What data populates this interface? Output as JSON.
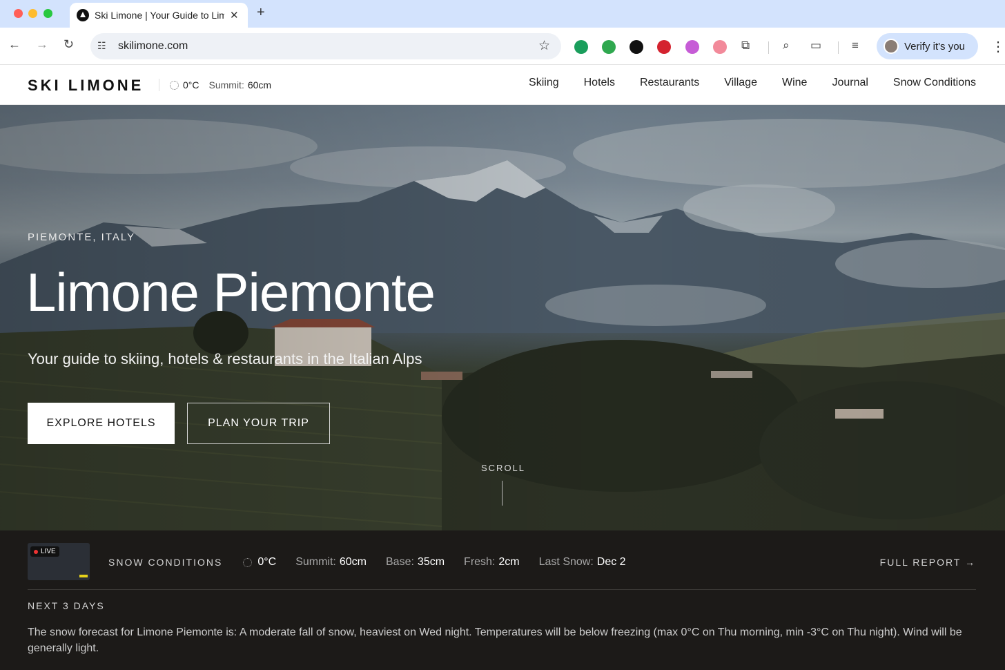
{
  "browser": {
    "tab_title": "Ski Limone | Your Guide to Limone Piemonte",
    "url": "skilimone.com",
    "profile_label": "Verify it's you",
    "extension_colors": [
      "#1a9e5c",
      "#2fa84f",
      "#111111",
      "#d4232f",
      "#c65cd6",
      "#f28a9a"
    ]
  },
  "header": {
    "logo": "SKI LIMONE",
    "temp": "0°C",
    "summit_label": "Summit:",
    "summit_value": "60cm",
    "nav": [
      "Skiing",
      "Hotels",
      "Restaurants",
      "Village",
      "Wine",
      "Journal",
      "Snow Conditions"
    ]
  },
  "hero": {
    "eyebrow": "PIEMONTE, ITALY",
    "title": "Limone Piemonte",
    "subtitle": "Your guide to skiing, hotels & restaurants in the Italian Alps",
    "primary_cta": "EXPLORE HOTELS",
    "secondary_cta": "PLAN YOUR TRIP",
    "scroll_label": "SCROLL"
  },
  "conditions": {
    "live_badge": "LIVE",
    "label": "SNOW CONDITIONS",
    "temp": "0°C",
    "summit_label": "Summit:",
    "summit_value": "60cm",
    "base_label": "Base:",
    "base_value": "35cm",
    "fresh_label": "Fresh:",
    "fresh_value": "2cm",
    "last_snow_label": "Last Snow:",
    "last_snow_value": "Dec 2",
    "full_report": "FULL REPORT →",
    "next_heading": "NEXT 3 DAYS",
    "forecast": "The snow forecast for Limone Piemonte is: A moderate fall of snow, heaviest on Wed night. Temperatures will be below freezing (max 0°C on Thu morning, min -3°C on Thu night). Wind will be generally light."
  }
}
